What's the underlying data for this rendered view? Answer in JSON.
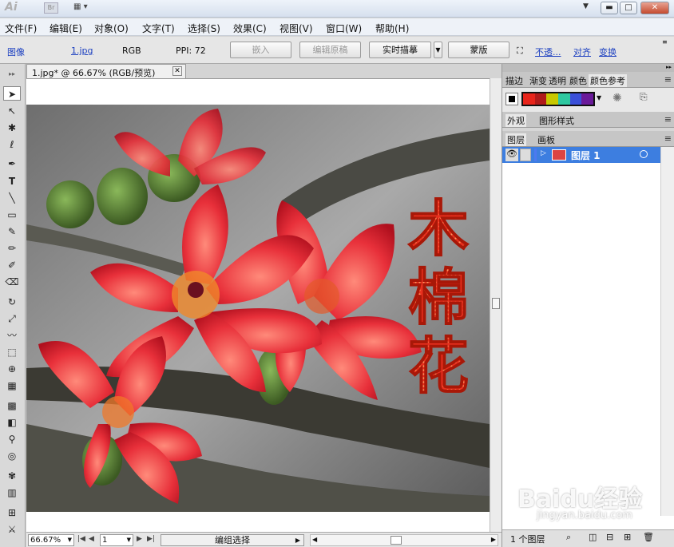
{
  "window": {
    "logo": "Ai",
    "bridge_label": "Br",
    "dropdown_glyph": "▼"
  },
  "menu": [
    "文件(F)",
    "编辑(E)",
    "对象(O)",
    "文字(T)",
    "选择(S)",
    "效果(C)",
    "视图(V)",
    "窗口(W)",
    "帮助(H)"
  ],
  "control": {
    "object_type": "图像",
    "file_name": "1.jpg",
    "color_mode": "RGB",
    "ppi": "PPI: 72",
    "embed_button": "嵌入",
    "edit_original_button": "编辑原稿",
    "live_trace_button": "实时描摹",
    "mask_button": "蒙版",
    "opacity_link": "不透...",
    "align_link": "对齐",
    "transform_link": "变换"
  },
  "document": {
    "tab_title": "1.jpg* @ 66.67% (RGB/预览)",
    "artwork_text": [
      "木",
      "棉",
      "花"
    ]
  },
  "status": {
    "zoom": "66.67%",
    "page": "1",
    "status_text": "编组选择"
  },
  "panels": {
    "top_tabs": [
      "描边",
      "渐变",
      "透明",
      "颜色",
      "颜色参考"
    ],
    "mid_tabs": [
      "外观",
      "图形样式"
    ],
    "layer_tabs": [
      "图层",
      "画板"
    ],
    "layer_name": "图层 1",
    "layer_count": "1 个图层",
    "swatch_colors": [
      "#e8241a",
      "#b01a1a",
      "#c8c800",
      "#2ec8a0",
      "#3a4fd8",
      "#6a1a9a"
    ]
  },
  "watermark": {
    "brand": "Baidu经验",
    "url": "jingyan.baidu.com"
  }
}
